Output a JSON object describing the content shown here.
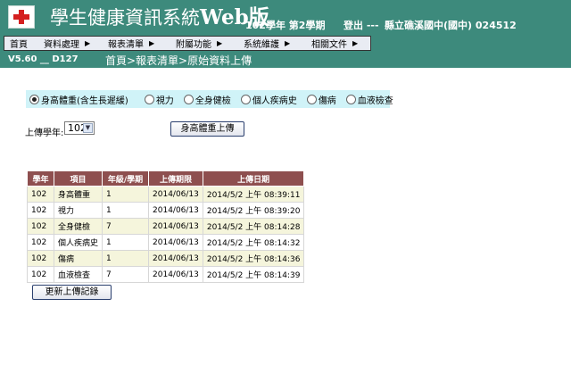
{
  "header": {
    "title_main": "學生健康資訊系統",
    "title_web": "Web版",
    "term": "102學年 第2學期",
    "login": "登出 ---",
    "school": "縣立礁溪國中(國中) 024512"
  },
  "menu": [
    {
      "label": "首頁",
      "arrow": ""
    },
    {
      "label": "資料處理",
      "arrow": "▶"
    },
    {
      "label": "報表清單",
      "arrow": "▶"
    },
    {
      "label": "附屬功能",
      "arrow": "▶"
    },
    {
      "label": "系統維護",
      "arrow": "▶"
    },
    {
      "label": "相關文件",
      "arrow": "▶"
    }
  ],
  "version": "V5.60 __ D127",
  "breadcrumb": "首頁>報表清單>原始資料上傳",
  "upload_options": [
    {
      "label": "身高體重(含生長遲緩)",
      "selected": true
    },
    {
      "label": "視力",
      "selected": false
    },
    {
      "label": "全身健檢",
      "selected": false
    },
    {
      "label": "個人疾病史",
      "selected": false
    },
    {
      "label": "傷病",
      "selected": false
    },
    {
      "label": "血液檢查",
      "selected": false
    }
  ],
  "year_label": "上傳學年:",
  "year_value": "102",
  "upload_button": "身高體重上傳",
  "table": {
    "headers": [
      "學年",
      "項目",
      "年級/學期",
      "上傳期限",
      "上傳日期"
    ],
    "rows": [
      [
        "102",
        "身高體重",
        "1",
        "2014/06/13",
        "2014/5/2 上午 08:39:11"
      ],
      [
        "102",
        "視力",
        "1",
        "2014/06/13",
        "2014/5/2 上午 08:39:20"
      ],
      [
        "102",
        "全身健檢",
        "7",
        "2014/06/13",
        "2014/5/2 上午 08:14:28"
      ],
      [
        "102",
        "個人疾病史",
        "1",
        "2014/06/13",
        "2014/5/2 上午 08:14:32"
      ],
      [
        "102",
        "傷病",
        "1",
        "2014/06/13",
        "2014/5/2 上午 08:14:36"
      ],
      [
        "102",
        "血液檢查",
        "7",
        "2014/06/13",
        "2014/5/2 上午 08:14:39"
      ]
    ]
  },
  "refresh_button": "更新上傳記錄",
  "colors": {
    "header_bg": "#3d8a7c",
    "table_header_bg": "#8e4f4f",
    "option_bar_bg": "#d0f3f8",
    "row_alt_bg": "#f5f5dc"
  },
  "icons": {
    "logo": "red-cross-icon",
    "menu_arrow": "triangle-right-icon",
    "select": "chevron-down-icon"
  }
}
